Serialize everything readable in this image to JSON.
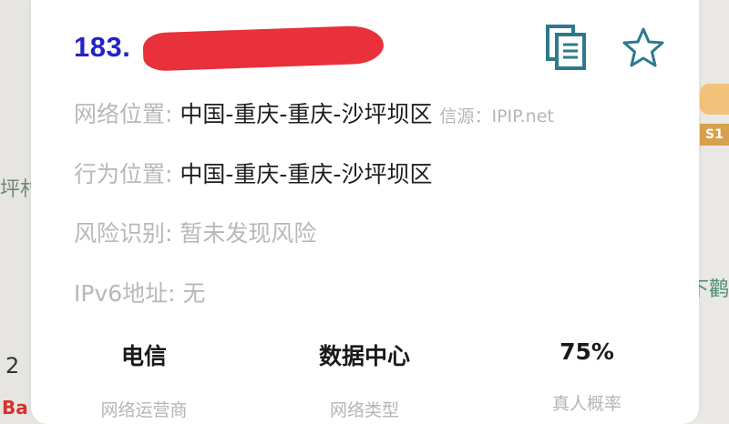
{
  "header": {
    "ip_visible": "183.",
    "copy_icon": "copy-icon",
    "favorite_icon": "star-icon"
  },
  "info": {
    "network_location": {
      "label": "网络位置:",
      "value": "中国-重庆-重庆-沙坪坝区",
      "source": "信源：IPIP.net"
    },
    "behavior_location": {
      "label": "行为位置:",
      "value": "中国-重庆-重庆-沙坪坝区"
    },
    "risk": {
      "label": "风险识别:",
      "value": "暂未发现风险"
    },
    "ipv6": {
      "label": "IPv6地址:",
      "value": "无"
    }
  },
  "stats": [
    {
      "value": "电信",
      "label": "网络运营商"
    },
    {
      "value": "数据中心",
      "label": "网络类型"
    },
    {
      "value": "75%",
      "label": "真人概率"
    }
  ],
  "background_map": {
    "left_place": "坪村",
    "left_scale": "2",
    "left_logo": "Ba",
    "right_badge": "S1",
    "right_place": "下鹳"
  },
  "colors": {
    "ip": "#2323c8",
    "redaction": "#e8313b",
    "icon_teal": "#2c7a8c"
  }
}
